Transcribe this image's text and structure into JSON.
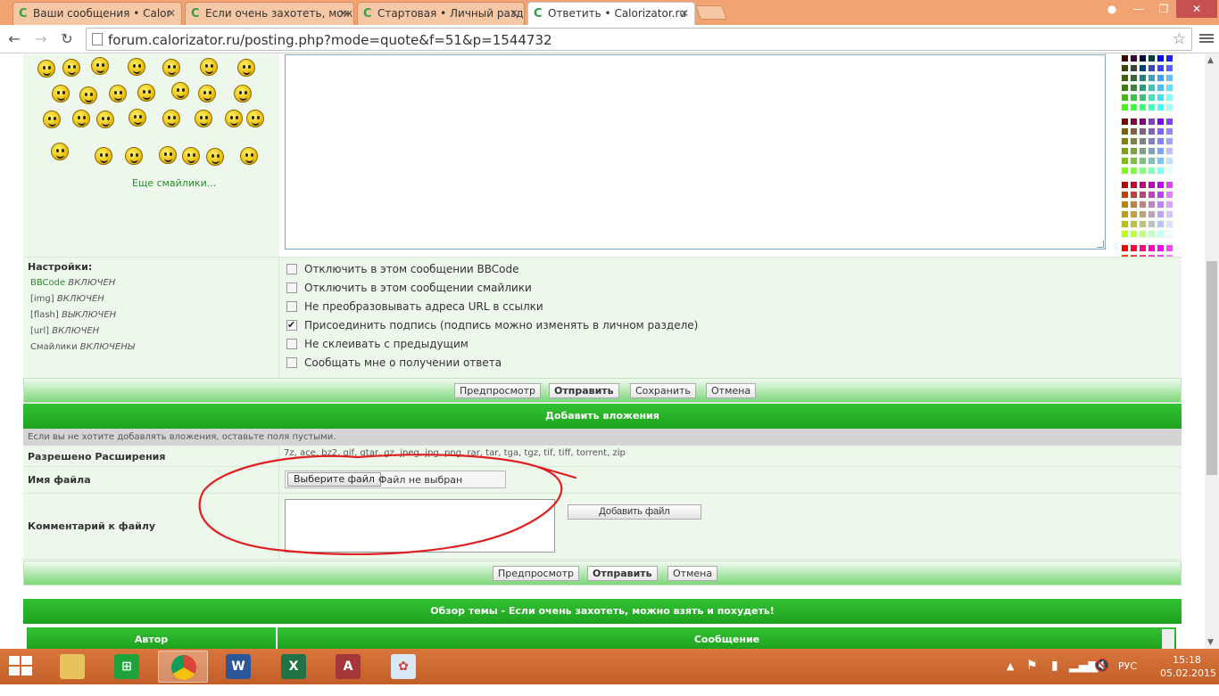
{
  "browser": {
    "tabs": [
      {
        "title": "Ваши сообщения • Calor",
        "favicon": "C"
      },
      {
        "title": "Если очень захотеть, мож",
        "favicon": "C"
      },
      {
        "title": "Стартовая • Личный разд",
        "favicon": "C"
      },
      {
        "title": "Ответить • Calorizator.ru",
        "favicon": "C"
      }
    ],
    "active_tab": 3,
    "close_glyph": "✕",
    "url": "forum.calorizator.ru/posting.php?mode=quote&f=51&p=1544732"
  },
  "smilies": {
    "more_link": "Еще смайлики..."
  },
  "settings": {
    "heading": "Настройки:",
    "status_lines": [
      {
        "name": "BBCode",
        "state": "ВКЛЮЧЕН"
      },
      {
        "name": "[img]",
        "state": "ВКЛЮЧЕН"
      },
      {
        "name": "[flash]",
        "state": "ВЫКЛЮЧЕН"
      },
      {
        "name": "[url]",
        "state": "ВКЛЮЧЕН"
      },
      {
        "name": "Смайлики",
        "state": "ВКЛЮЧЕНЫ"
      }
    ],
    "options": [
      {
        "label": "Отключить в этом сообщении BBCode",
        "checked": false
      },
      {
        "label": "Отключить в этом сообщении смайлики",
        "checked": false
      },
      {
        "label": "Не преобразовывать адреса URL в ссылки",
        "checked": false
      },
      {
        "label": "Присоединить подпись (подпись можно изменять в личном разделе)",
        "checked": true
      },
      {
        "label": "Не склеивать с предыдущим",
        "checked": false
      },
      {
        "label": "Сообщать мне о получении ответа",
        "checked": false
      }
    ]
  },
  "buttons_top": {
    "preview": "Предпросмотр",
    "submit": "Отправить",
    "save": "Сохранить",
    "cancel": "Отмена"
  },
  "attachments": {
    "title": "Добавить вложения",
    "hint": "Если вы не хотите добавлять вложения, оставьте поля пустыми.",
    "extensions_label": "Разрешено Расширения",
    "extensions_value": "7z, ace, bz2, gif, gtar, gz, jpeg, jpg, png, rar, tar, tga, tgz, tif, tiff, torrent, zip",
    "filename_label": "Имя файла",
    "choose_file": "Выберите файл",
    "no_file": "Файл не выбран",
    "comment_label": "Комментарий к файлу",
    "add_file": "Добавить файл"
  },
  "buttons_bottom": {
    "preview": "Предпросмотр",
    "submit": "Отправить",
    "cancel": "Отмена"
  },
  "review": {
    "title": "Обзор темы - Если очень захотеть, можно взять и похудеть!",
    "col_author": "Автор",
    "col_message": "Сообщение"
  },
  "taskbar": {
    "apps": [
      "file-explorer",
      "store",
      "chrome",
      "word",
      "excel",
      "access",
      "paint"
    ],
    "tray_lang": "РУС",
    "time": "15:18",
    "date": "05.02.2015"
  },
  "colors": {
    "green_header": "#1fa21f",
    "panel_bg": "#edf7ec",
    "annotation_red": "#e02020",
    "taskbar": "#c25f29"
  }
}
